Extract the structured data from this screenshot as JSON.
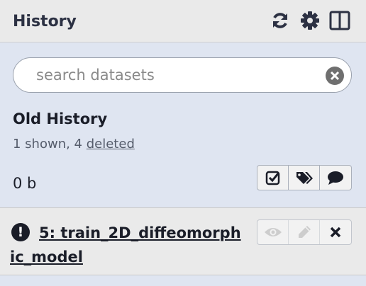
{
  "header": {
    "title": "History",
    "icons": [
      "refresh-icon",
      "gear-icon",
      "split-view-icon"
    ]
  },
  "search": {
    "placeholder": "search datasets",
    "value": ""
  },
  "history": {
    "name": "Old History",
    "shown_text": "1 shown, 4 ",
    "deleted_link": "deleted",
    "size": "0 b",
    "action_icons": [
      "checkbox-icon",
      "tags-icon",
      "comment-icon"
    ]
  },
  "dataset": {
    "title": "5: train_2D_diffeomorphic_model",
    "state_icon": "exclamation-icon",
    "action_icons": [
      "eye-icon",
      "pencil-icon",
      "delete-icon"
    ]
  },
  "colors": {
    "panel_bg": "#dfe5f1",
    "header_bg": "#eaeaea",
    "text": "#2c3143"
  }
}
